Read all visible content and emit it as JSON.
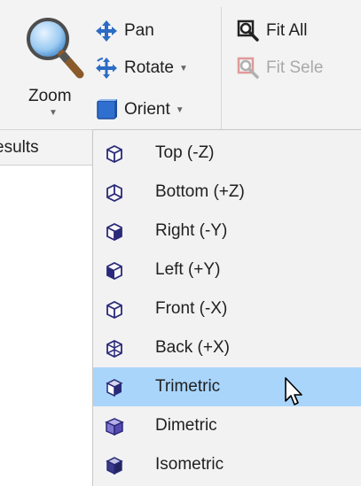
{
  "ribbon": {
    "zoom_label": "Zoom",
    "pan_label": "Pan",
    "rotate_label": "Rotate",
    "orient_label": "Orient",
    "fit_all_label": "Fit All",
    "fit_selection_label": "Fit Sele",
    "results_tab_label": "esults"
  },
  "orient_menu": {
    "items": [
      {
        "label": "Top (-Z)",
        "icon": "cube-top-icon"
      },
      {
        "label": "Bottom (+Z)",
        "icon": "cube-bottom-icon"
      },
      {
        "label": "Right (-Y)",
        "icon": "cube-right-icon"
      },
      {
        "label": "Left (+Y)",
        "icon": "cube-left-icon"
      },
      {
        "label": "Front (-X)",
        "icon": "cube-front-icon"
      },
      {
        "label": "Back (+X)",
        "icon": "cube-back-icon"
      },
      {
        "label": "Trimetric",
        "icon": "cube-trimetric-icon",
        "selected": true
      },
      {
        "label": "Dimetric",
        "icon": "cube-dimetric-icon"
      },
      {
        "label": "Isometric",
        "icon": "cube-isometric-icon"
      }
    ]
  },
  "colors": {
    "accent": "#2b6cc4",
    "selected_bg": "#a9d5fb",
    "cube_dark": "#2a2a7a"
  }
}
